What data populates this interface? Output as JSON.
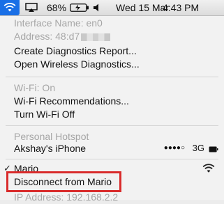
{
  "menubar": {
    "wifi_icon": "wifi-icon",
    "airplay_icon": "airplay-icon",
    "battery_percent": "68%",
    "battery_icon": "battery-charging-icon",
    "volume_icon": "volume-icon",
    "date": "Wed 15 Mar",
    "time": "4:43 PM",
    "active_color": "#1a6fe6"
  },
  "menu": {
    "interface_name": "Interface Name: en0",
    "address": "Address: 48:d7",
    "create_diagnostics": "Create Diagnostics Report...",
    "open_wireless_diagnostics": "Open Wireless Diagnostics...",
    "wifi_status": "Wi-Fi: On",
    "wifi_recommendations": "Wi-Fi Recommendations...",
    "turn_wifi_off": "Turn Wi-Fi Off",
    "personal_hotspot_header": "Personal Hotspot",
    "hotspot_device": "Akshay's iPhone",
    "hotspot_signal": "●●●●○",
    "hotspot_network_type": "3G",
    "connected_network": "Mario",
    "disconnect": "Disconnect from Mario",
    "ip_address": "IP Address: 192.168.2.2",
    "highlight_color": "#d92b2b"
  }
}
